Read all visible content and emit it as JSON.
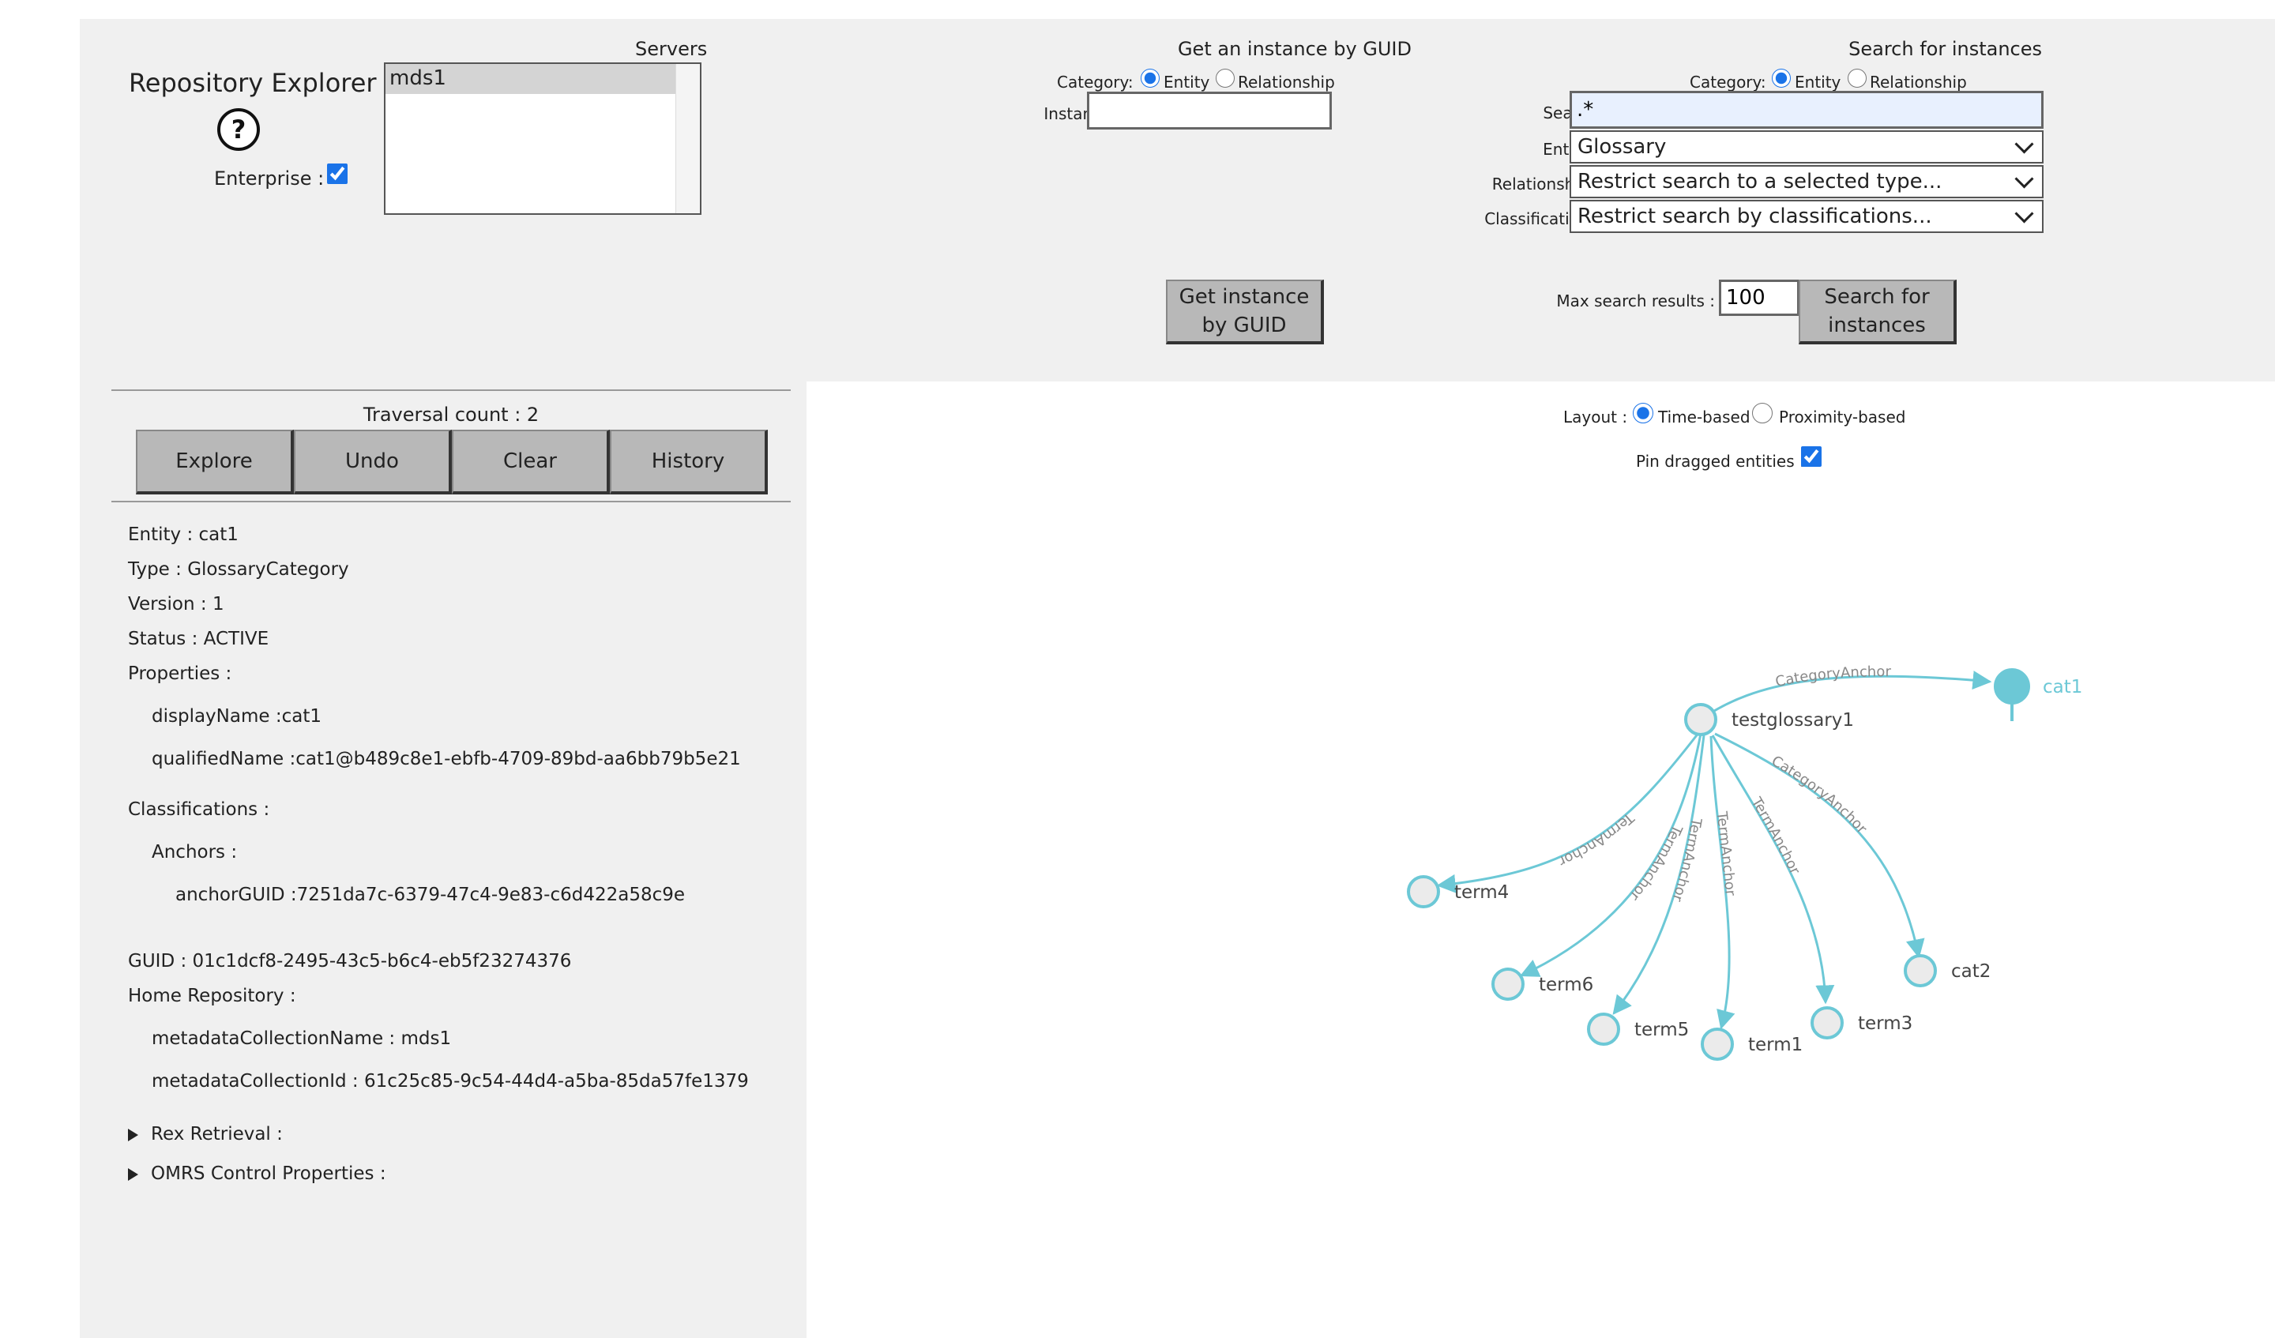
{
  "header": {
    "title": "Repository Explorer",
    "enterprise_label": "Enterprise :",
    "enterprise_checked": true
  },
  "servers": {
    "label": "Servers",
    "items": [
      "mds1"
    ],
    "selected": "mds1"
  },
  "guid_search": {
    "title": "Get an instance by GUID",
    "category_label": "Category:",
    "entity_option": "Entity",
    "relationship_option": "Relationship",
    "instance_guid_label": "Instance GUID:",
    "instance_guid_value": "",
    "button": "Get instance by GUID"
  },
  "instance_search": {
    "title": "Search for instances",
    "category_label": "Category:",
    "entity_option": "Entity",
    "relationship_option": "Relationship",
    "search_text_label": "Search text :",
    "search_text_value": ".*",
    "entity_types_label": "Entity Types:",
    "entity_types_value": "Glossary",
    "relationship_types_label": "Relationship Types:",
    "relationship_types_value": "Restrict search to a selected type...",
    "classification_types_label": "Classification Types:",
    "classification_types_value": "Restrict search by classifications...",
    "max_results_label": "Max search results :",
    "max_results_value": "100",
    "button": "Search for instances"
  },
  "traversal": {
    "count_label": "Traversal count : 2",
    "buttons": [
      "Explore",
      "Undo",
      "Clear",
      "History"
    ]
  },
  "details": {
    "entity": "Entity : cat1",
    "type": "Type : GlossaryCategory",
    "version": "Version : 1",
    "status": "Status : ACTIVE",
    "properties_label": "Properties :",
    "display_name": "displayName :cat1",
    "qualified_name": "qualifiedName :cat1@b489c8e1-ebfb-4709-89bd-aa6bb79b5e21",
    "classifications_label": "Classifications :",
    "anchors_label": "Anchors :",
    "anchor_guid": "anchorGUID :7251da7c-6379-47c4-9e83-c6d422a58c9e",
    "guid": "GUID : 01c1dcf8-2495-43c5-b6c4-eb5f23274376",
    "home_repo_label": "Home Repository :",
    "collection_name": "metadataCollectionName : mds1",
    "collection_id": "metadataCollectionId : 61c25c85-9c54-44d4-a5ba-85da57fe1379",
    "rex_retrieval": "Rex Retrieval :",
    "omrs_control": "OMRS Control Properties :"
  },
  "graph_controls": {
    "layout_label": "Layout :",
    "time_based": "Time-based",
    "proximity_based": "Proximity-based",
    "pin_label": "Pin dragged entities :",
    "pin_checked": true
  },
  "graph": {
    "node_color": "#6cc8d6",
    "nodes": [
      {
        "id": "testglossary1",
        "label": "testglossary1",
        "selected": false
      },
      {
        "id": "cat1",
        "label": "cat1",
        "selected": true
      },
      {
        "id": "term4",
        "label": "term4",
        "selected": false
      },
      {
        "id": "term6",
        "label": "term6",
        "selected": false
      },
      {
        "id": "term5",
        "label": "term5",
        "selected": false
      },
      {
        "id": "term1",
        "label": "term1",
        "selected": false
      },
      {
        "id": "term3",
        "label": "term3",
        "selected": false
      },
      {
        "id": "cat2",
        "label": "cat2",
        "selected": false
      }
    ],
    "edges": [
      {
        "from": "testglossary1",
        "to": "cat1",
        "label": "CategoryAnchor"
      },
      {
        "from": "testglossary1",
        "to": "term4",
        "label": "TermAnchor"
      },
      {
        "from": "testglossary1",
        "to": "term6",
        "label": "TermAnchor"
      },
      {
        "from": "testglossary1",
        "to": "term5",
        "label": "TermAnchor"
      },
      {
        "from": "testglossary1",
        "to": "term1",
        "label": "TermAnchor"
      },
      {
        "from": "testglossary1",
        "to": "term3",
        "label": "TermAnchor"
      },
      {
        "from": "testglossary1",
        "to": "cat2",
        "label": "CategoryAnchor"
      }
    ]
  }
}
